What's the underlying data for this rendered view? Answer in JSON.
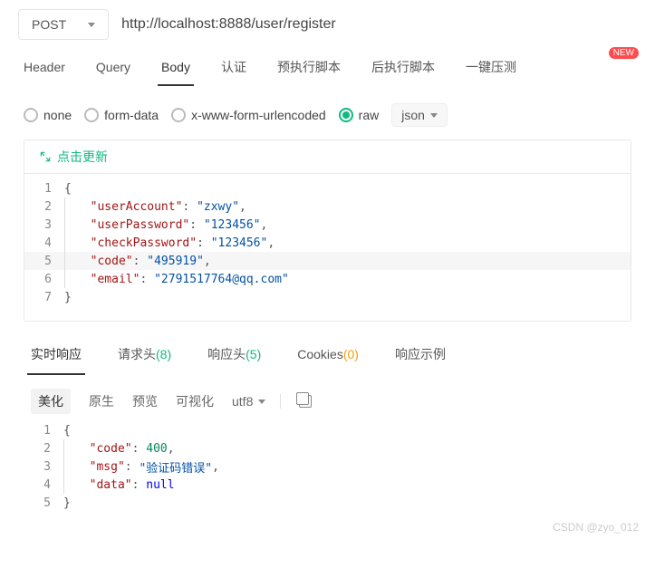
{
  "request": {
    "method": "POST",
    "url": "http://localhost:8888/user/register"
  },
  "tabs": {
    "header": "Header",
    "query": "Query",
    "body": "Body",
    "auth": "认证",
    "preScript": "预执行脚本",
    "postScript": "后执行脚本",
    "pressureTest": "一键压测",
    "newBadge": "NEW"
  },
  "bodyType": {
    "none": "none",
    "formData": "form-data",
    "xwww": "x-www-form-urlencoded",
    "raw": "raw",
    "rawFormat": "json"
  },
  "clickUpdate": "点击更新",
  "requestBody": {
    "userAccountKey": "\"userAccount\"",
    "userAccountVal": "\"zxwy\"",
    "userPasswordKey": "\"userPassword\"",
    "userPasswordVal": "\"123456\"",
    "checkPasswordKey": "\"checkPassword\"",
    "checkPasswordVal": "\"123456\"",
    "codeKey": "\"code\"",
    "codeVal": "\"495919\"",
    "emailKey": "\"email\"",
    "emailVal": "\"2791517764@qq.com\""
  },
  "respTabs": {
    "realtime": "实时响应",
    "reqHeader": "请求头",
    "reqHeaderCount": "(8)",
    "respHeader": "响应头",
    "respHeaderCount": "(5)",
    "cookies": "Cookies",
    "cookiesCount": "(0)",
    "respExample": "响应示例"
  },
  "fmt": {
    "beautify": "美化",
    "raw": "原生",
    "preview": "预览",
    "visual": "可视化",
    "encoding": "utf8"
  },
  "response": {
    "codeKey": "\"code\"",
    "codeVal": "400",
    "msgKey": "\"msg\"",
    "msgVal": "\"验证码错误\"",
    "dataKey": "\"data\"",
    "dataVal": "null"
  },
  "watermark": "CSDN @zyo_012"
}
